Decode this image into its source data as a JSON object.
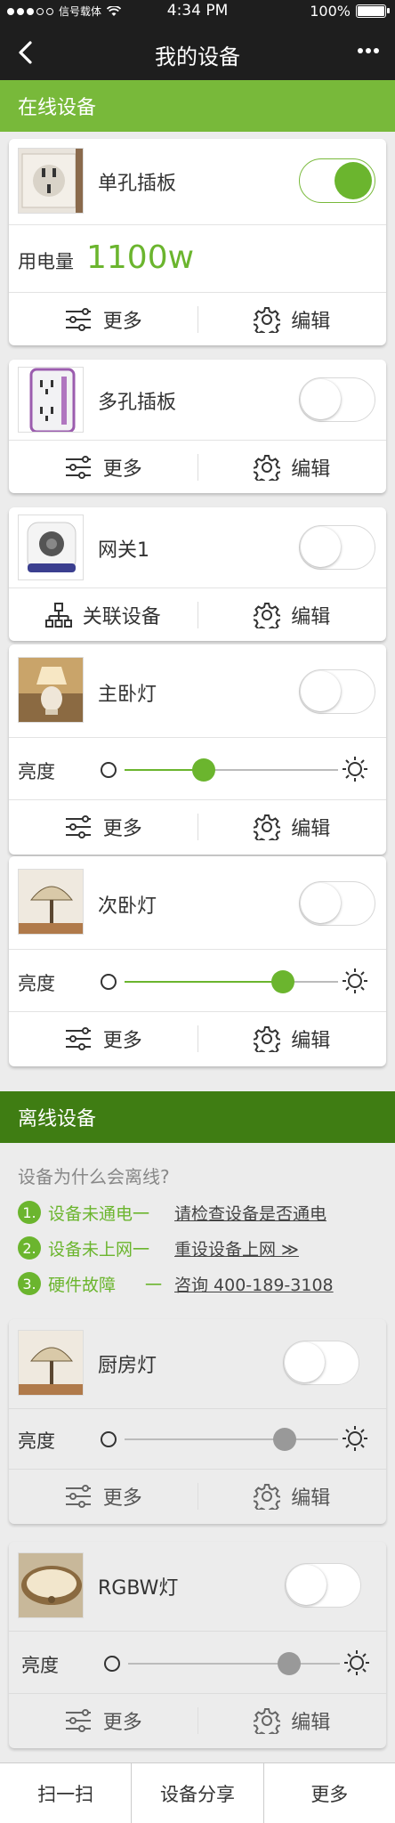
{
  "status_bar": {
    "carrier": "信号载体",
    "time": "4:34 PM",
    "battery": "100%"
  },
  "nav": {
    "title": "我的设备"
  },
  "online_section": {
    "title": "在线设备"
  },
  "offline_section": {
    "title": "离线设备"
  },
  "labels": {
    "more": "更多",
    "edit": "编辑",
    "related": "关联设备",
    "brightness": "亮度",
    "usage": "用电量"
  },
  "online_devices": [
    {
      "name": "单孔插板",
      "on": true,
      "usage": "1100w"
    },
    {
      "name": "多孔插板",
      "on": false
    },
    {
      "name": "网关1",
      "on": false
    },
    {
      "name": "主卧灯",
      "on": false,
      "brightness": 0.37
    },
    {
      "name": "次卧灯",
      "on": false,
      "brightness": 0.74
    }
  ],
  "offline_help": {
    "question": "设备为什么会离线?",
    "items": [
      {
        "num": "1.",
        "reason": "设备未通电一",
        "action": "请检查设备是否通电"
      },
      {
        "num": "2.",
        "reason": "设备未上网一",
        "action": "重设设备上网 ≫"
      },
      {
        "num": "3.",
        "reason": "硬件故障",
        "dash": "一",
        "action": "咨询 400-189-3108"
      }
    ]
  },
  "offline_devices": [
    {
      "name": "厨房灯",
      "on": false,
      "brightness": 0.75
    },
    {
      "name": "RGBW灯",
      "on": false,
      "brightness": 0.76
    }
  ],
  "tabbar": {
    "scan": "扫一扫",
    "share": "设备分享",
    "more": "更多"
  },
  "colors": {
    "accent": "#6bb52e",
    "online_header": "#78b93a",
    "offline_header": "#3f7d13",
    "bar": "#1e1e1e"
  }
}
